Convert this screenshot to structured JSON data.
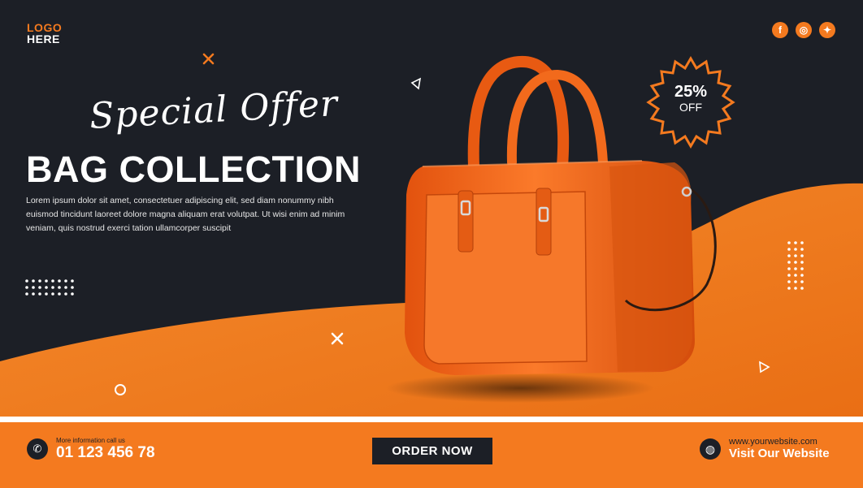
{
  "logo": {
    "line1": "LOGO",
    "line2": "HERE"
  },
  "socials": [
    {
      "icon": "facebook-icon",
      "glyph": "f"
    },
    {
      "icon": "instagram-icon",
      "glyph": "◎"
    },
    {
      "icon": "twitter-icon",
      "glyph": "✦"
    }
  ],
  "headline": {
    "script": "Special Offer",
    "title": "BAG COLLECTION",
    "description": "Lorem ipsum dolor sit amet, consectetuer adipiscing elit, sed diam nonummy nibh euismod tincidunt laoreet dolore magna aliquam erat volutpat. Ut wisi enim ad minim veniam, quis nostrud exerci tation ullamcorper suscipit"
  },
  "badge": {
    "percent": "25%",
    "label": "OFF"
  },
  "footer": {
    "phone_caption": "More information call us",
    "phone_number": "01 123 456 78",
    "order_button": "ORDER NOW",
    "website_url": "www.yourwebsite.com",
    "website_cta": "Visit Our Website"
  },
  "colors": {
    "accent": "#f47a1f",
    "dark": "#1c1f26",
    "bag": "#f0641c"
  }
}
